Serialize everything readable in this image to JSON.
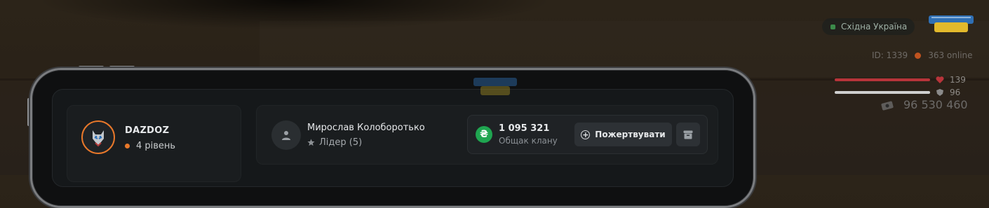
{
  "hud": {
    "region": "Східна Україна",
    "server_id": "ID: 1339",
    "online": "363 online",
    "health": "139",
    "armor": "96",
    "money": "96 530 460",
    "health_color": "#b8343a",
    "armor_color": "#d0d0d0"
  },
  "profile": {
    "nickname": "DAZDOZ",
    "level": "4 рівень",
    "accent_color": "#e8782a"
  },
  "clan": {
    "leader_name": "Мирослав Колоборотько",
    "leader_role": "Лідер (5)",
    "treasury_amount": "1 095 321",
    "treasury_label": "Общак клану",
    "treasury_currency_icon": "hryvnia-icon",
    "donate_label": "Пожертвувати"
  }
}
